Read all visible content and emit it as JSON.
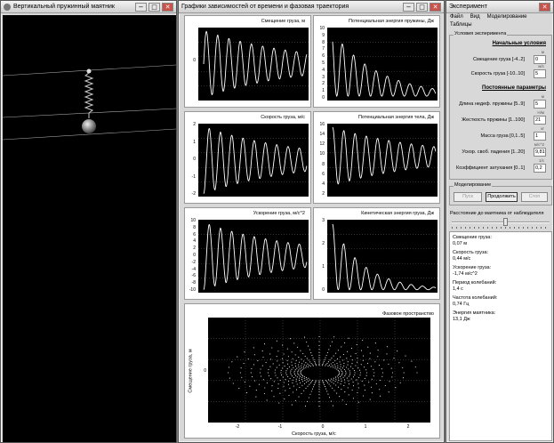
{
  "window_left": {
    "title": "Вертикальный пружинный маятник",
    "minimize": "−",
    "maximize": "□",
    "close": "✕"
  },
  "window_center": {
    "title": "Графики зависимостей от времени и фазовая траектория",
    "minimize": "−",
    "maximize": "□",
    "close": "✕",
    "plots": [
      {
        "title": "Смещение груза, м",
        "yticks": [
          "0"
        ]
      },
      {
        "title": "Потенциальная энергия пружины, Дж",
        "yticks": [
          "10",
          "9",
          "8",
          "7",
          "6",
          "5",
          "4",
          "3",
          "2",
          "1",
          "0"
        ]
      },
      {
        "title": "Скорость груза, м/с",
        "yticks": [
          "2",
          "1",
          "0",
          "-1",
          "-2"
        ]
      },
      {
        "title": "Потенциальная энергия тела, Дж",
        "yticks": [
          "16",
          "14",
          "12",
          "10",
          "8",
          "6",
          "4",
          "2"
        ]
      },
      {
        "title": "Ускорение груза, м/с^2",
        "yticks": [
          "10",
          "8",
          "6",
          "4",
          "2",
          "0",
          "-2",
          "-4",
          "-6",
          "-8",
          "-10"
        ]
      },
      {
        "title": "Кинетическая энергия груза, Дж",
        "yticks": [
          "3",
          "2",
          "1",
          "0"
        ]
      }
    ],
    "phase": {
      "title": "Фазовое пространство",
      "ylabel": "Смещение груза, м",
      "xlabel": "Скорость груза, м/с",
      "xticks": [
        "-2",
        "-1",
        "0",
        "1",
        "2"
      ],
      "ytick": "0"
    }
  },
  "window_right": {
    "title": "Эксперимент",
    "close": "✕",
    "menu": [
      "Файл",
      "Вид",
      "Моделирование"
    ],
    "menu2": "Таблицы",
    "conditions_group": "Условия эксперимента",
    "initial_header": "Начальные условия",
    "initial": [
      {
        "label": "Смещение груза [-4..2]",
        "value": "0",
        "unit": "м"
      },
      {
        "label": "Скорость груза [-10..10]",
        "value": "5",
        "unit": "м/с"
      }
    ],
    "params_header": "Постоянные параметры",
    "params": [
      {
        "label": "Длина недеф. пружины [5..9]",
        "value": "5",
        "unit": "м"
      },
      {
        "label": "Жесткость пружины [1..100]",
        "value": "21",
        "unit": "Н/м"
      },
      {
        "label": "Масса груза [0,1..5]",
        "value": "1",
        "unit": "кг"
      },
      {
        "label": "Ускор. своб. падения [1..20]",
        "value": "9,81",
        "unit": "м/с^2"
      },
      {
        "label": "Коэффициент затухания [0..1]",
        "value": "0,2",
        "unit": "1/с"
      }
    ],
    "modeling_group": "Моделирование",
    "buttons": {
      "start": "Пуск",
      "continue": "Продолжить",
      "stop": "Стоп"
    },
    "distance_label": "Расстояние до маятника от наблюдателя",
    "slider": 0.55,
    "outputs": [
      {
        "label": "Смещение груза:",
        "value": "0,07 м"
      },
      {
        "label": "Скорость груза:",
        "value": "0,44 м/с"
      },
      {
        "label": "Ускорение груза:",
        "value": "-1,74 м/с^2"
      },
      {
        "label": "Период колебаний:",
        "value": "1,4 с"
      },
      {
        "label": "Частота колебаний:",
        "value": "0,74 Гц"
      },
      {
        "label": "Энергия маятника:",
        "value": "13,1 Дж"
      }
    ]
  },
  "colors": {
    "plot_bg": "#000000",
    "curve": "#ffffff",
    "grid": "#777777"
  }
}
